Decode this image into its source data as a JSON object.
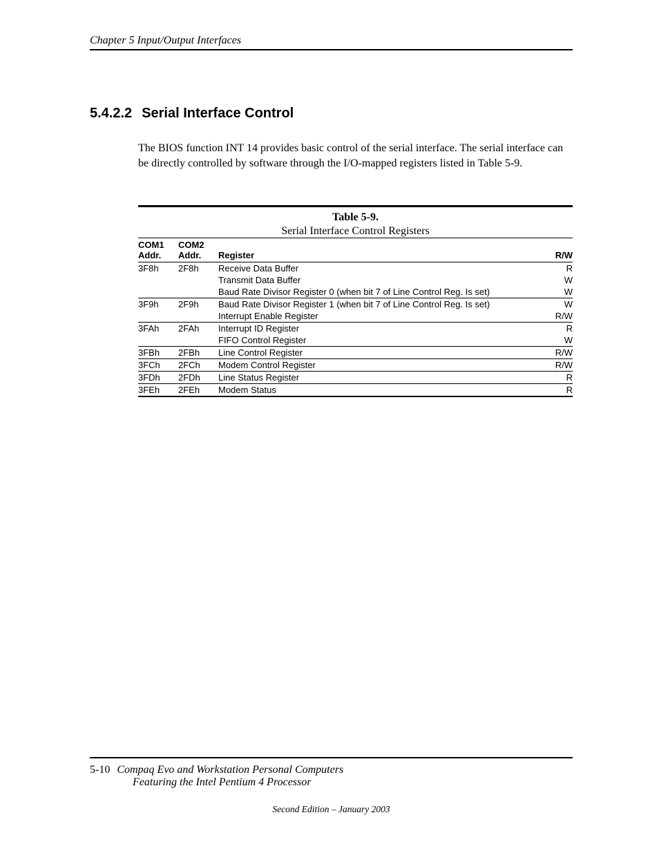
{
  "header": {
    "running": "Chapter 5  Input/Output Interfaces"
  },
  "section": {
    "number": "5.4.2.2",
    "title": "Serial Interface Control",
    "paragraph": "The BIOS function INT 14 provides basic control of the serial interface. The serial interface can be directly controlled by software through the I/O-mapped registers listed in Table 5-9."
  },
  "table": {
    "label": "Table 5-9.",
    "title": "Serial Interface Control Registers",
    "headers": {
      "com1_a": "COM1",
      "com1_b": "Addr.",
      "com2_a": "COM2",
      "com2_b": "Addr.",
      "reg": "Register",
      "rw": "R/W"
    },
    "rows": [
      {
        "c1": "3F8h",
        "c2": "2F8h",
        "reg": "Receive Data Buffer",
        "rw": "R"
      },
      {
        "c1": "",
        "c2": "",
        "reg": "Transmit Data Buffer",
        "rw": "W"
      },
      {
        "c1": "",
        "c2": "",
        "reg": "Baud Rate Divisor Register 0 (when bit 7 of Line Control Reg. Is set)",
        "rw": "W",
        "sep": true
      },
      {
        "c1": "3F9h",
        "c2": "2F9h",
        "reg": "Baud Rate Divisor Register 1 (when bit 7 of Line Control Reg. Is set)",
        "rw": "W"
      },
      {
        "c1": "",
        "c2": "",
        "reg": "Interrupt Enable Register",
        "rw": "R/W",
        "sep": true
      },
      {
        "c1": "3FAh",
        "c2": "2FAh",
        "reg": "Interrupt ID Register",
        "rw": "R"
      },
      {
        "c1": "",
        "c2": "",
        "reg": "FIFO Control Register",
        "rw": "W",
        "sep": true
      },
      {
        "c1": "3FBh",
        "c2": "2FBh",
        "reg": "Line Control Register",
        "rw": "R/W",
        "sep": true
      },
      {
        "c1": "3FCh",
        "c2": "2FCh",
        "reg": "Modem Control Register",
        "rw": "R/W",
        "sep": true
      },
      {
        "c1": "3FDh",
        "c2": "2FDh",
        "reg": "Line Status Register",
        "rw": "R",
        "sep": true
      },
      {
        "c1": "3FEh",
        "c2": "2FEh",
        "reg": "Modem Status",
        "rw": "R",
        "last": true
      }
    ]
  },
  "footer": {
    "page": "5-10",
    "title": "Compaq Evo and Workstation Personal Computers",
    "subtitle": "Featuring the Intel Pentium 4 Processor",
    "edition": "Second Edition – January 2003"
  }
}
